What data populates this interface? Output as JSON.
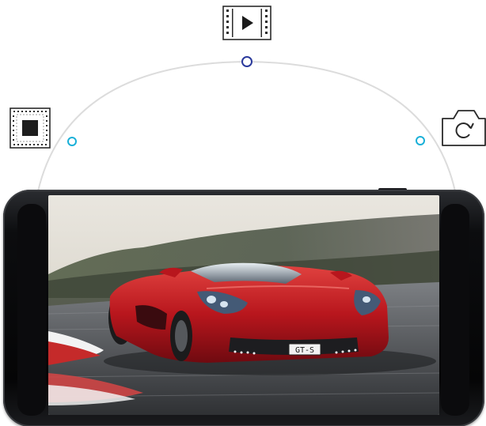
{
  "modes": [
    {
      "id": "stop",
      "icon": "stop-square-icon",
      "label": ""
    },
    {
      "id": "play",
      "icon": "play-film-icon",
      "label": ""
    },
    {
      "id": "rotate",
      "icon": "camera-rotate-icon",
      "label": ""
    }
  ],
  "selector": {
    "active_index": 1,
    "active_color": "#2b3a9c",
    "inactive_color": "#1ab0d8",
    "arc_color": "#dcdcdc"
  },
  "screen": {
    "content": "red-sports-car-on-race-track",
    "badge_text": "GT-S"
  }
}
